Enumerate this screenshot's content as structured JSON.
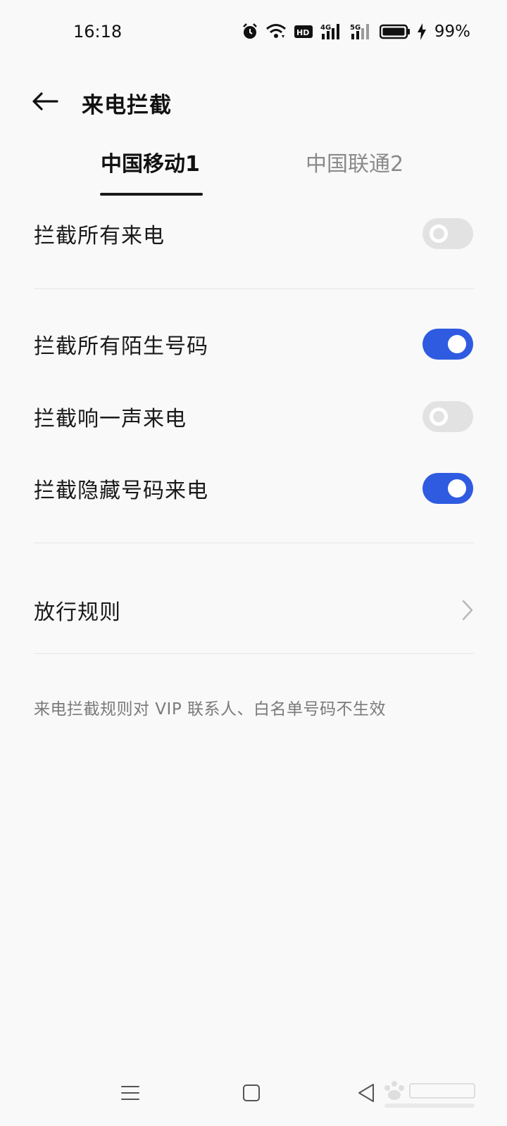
{
  "status_bar": {
    "time": "16:18",
    "battery_percent": "99%",
    "icons": [
      "alarm-icon",
      "wifi-icon",
      "hd-icon",
      "signal-4g-icon",
      "signal-5g-icon",
      "battery-icon",
      "charging-icon"
    ]
  },
  "header": {
    "title": "来电拦截",
    "back_icon": "back-arrow-icon"
  },
  "tabs": [
    {
      "label": "中国移动1",
      "active": true
    },
    {
      "label": "中国联通2",
      "active": false
    }
  ],
  "settings": [
    {
      "label": "拦截所有来电",
      "enabled": false
    },
    {
      "label": "拦截所有陌生号码",
      "enabled": true
    },
    {
      "label": "拦截响一声来电",
      "enabled": false
    },
    {
      "label": "拦截隐藏号码来电",
      "enabled": true
    }
  ],
  "allow_rules": {
    "label": "放行规则",
    "icon": "chevron-right-icon"
  },
  "note": "来电拦截规则对 VIP 联系人、白名单号码不生效",
  "nav_bar": {
    "icons": [
      "menu-icon",
      "home-icon",
      "back-triangle-icon"
    ]
  },
  "colors": {
    "accent": "#2f5be0",
    "toggle_off": "#e2e2e2",
    "background": "#f9f9f9"
  }
}
